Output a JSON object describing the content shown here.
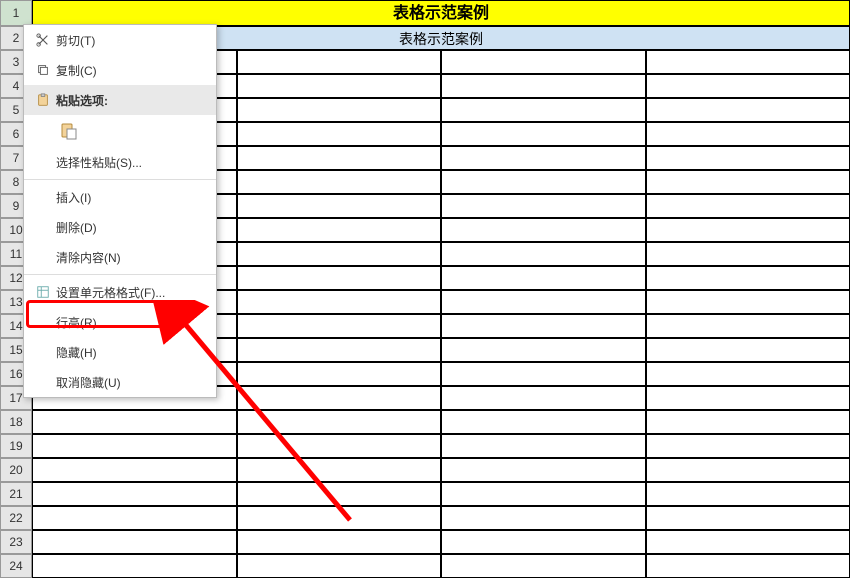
{
  "title": "表格示范案例",
  "subtitle": "表格示范案例",
  "rows": [
    1,
    2,
    3,
    4,
    5,
    6,
    7,
    8,
    9,
    10,
    11,
    12,
    13,
    14,
    15,
    16,
    17,
    18,
    19,
    20,
    21,
    22,
    23,
    24
  ],
  "menu": {
    "cut": "剪切(T)",
    "copy": "复制(C)",
    "paste_header": "粘贴选项:",
    "paste_special": "选择性粘贴(S)...",
    "insert": "插入(I)",
    "delete": "删除(D)",
    "clear": "清除内容(N)",
    "format_cells": "设置单元格格式(F)...",
    "row_height": "行高(R)...",
    "hide": "隐藏(H)",
    "unhide": "取消隐藏(U)"
  }
}
